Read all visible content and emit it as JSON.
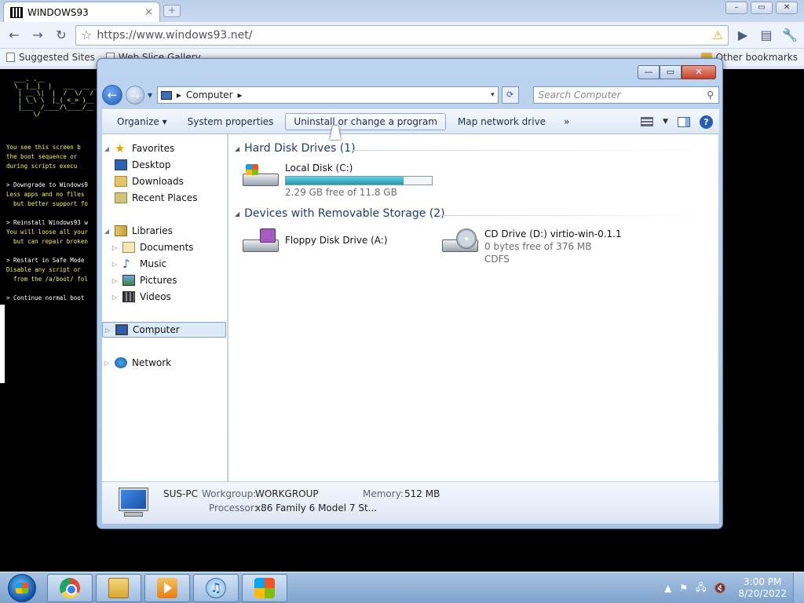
{
  "browser": {
    "tab_title": "WINDOWS93",
    "tab_close": "×",
    "newtab": "+",
    "win_min": "–",
    "win_max": "▭",
    "win_close": "✕",
    "url": "https://www.windows93.net/",
    "bookmarks": [
      {
        "label": "Suggested Sites"
      },
      {
        "label": "Web Slice Gallery"
      }
    ],
    "other_bookmarks": "Other bookmarks",
    "icons": {
      "back": "←",
      "forward": "→",
      "reload": "↻",
      "star": "☆",
      "warning": "⚠",
      "go": "▶",
      "page": "▤",
      "wrench": "🔧"
    }
  },
  "bootscreen": {
    "ascii": "___. .__\n\\_ |__|  |   ___  __ ___\n | __ \\|  |  /  \\/  / _ \\_\n | \\_\\ \\  |_( <_> )__\n |___  /____/\\____/__\n     \\/",
    "lines": [
      {
        "text": "You see this screen b",
        "color": "y"
      },
      {
        "text": "the boot sequence or",
        "color": "y"
      },
      {
        "text": "during scripts execu",
        "color": "y"
      },
      {
        "text": "> Downgrade to Windows9",
        "color": "w"
      },
      {
        "text": "Less apps and no files",
        "color": "y"
      },
      {
        "text": "  but better support fo",
        "color": "y"
      },
      {
        "text": "> Reinstall Windows93 w",
        "color": "w"
      },
      {
        "text": "You will loose all your",
        "color": "y"
      },
      {
        "text": "  but can repair broken",
        "color": "y"
      },
      {
        "text": "> Restart in Safe Mode",
        "color": "w"
      },
      {
        "text": "Disable any script or",
        "color": "y"
      },
      {
        "text": "  from the /a/boot/ fol",
        "color": "y"
      },
      {
        "text": "> Continue normal boot",
        "color": "w"
      }
    ]
  },
  "explorer": {
    "caption_buttons": {
      "minimize": "—",
      "maximize": "▭",
      "close": "✕"
    },
    "address": {
      "root_arrow": "▸",
      "location": "Computer",
      "after_arrow": "▸",
      "dropdown": "▾",
      "refresh": "⟳"
    },
    "search_placeholder": "Search Computer",
    "commands": {
      "organize": "Organize ▾",
      "system_properties": "System properties",
      "uninstall": "Uninstall or change a program",
      "map_network": "Map network drive",
      "more": "»",
      "help": "?"
    },
    "nav": {
      "favorites": "Favorites",
      "desktop": "Desktop",
      "downloads": "Downloads",
      "recent": "Recent Places",
      "libraries": "Libraries",
      "documents": "Documents",
      "music": "Music",
      "pictures": "Pictures",
      "videos": "Videos",
      "computer": "Computer",
      "network": "Network"
    },
    "groups": {
      "hdd": "Hard Disk Drives (1)",
      "removable": "Devices with Removable Storage (2)"
    },
    "drives": {
      "local": {
        "name": "Local Disk (C:)",
        "free": "2.29 GB free of 11.8 GB",
        "used_fraction": 0.806
      },
      "floppy": {
        "name": "Floppy Disk Drive (A:)"
      },
      "cd": {
        "name": "CD Drive (D:) virtio-win-0.1.1",
        "free": "0 bytes free of 376 MB",
        "fs": "CDFS"
      }
    },
    "details": {
      "pc_name": "SUS-PC",
      "workgroup_label": "Workgroup:",
      "workgroup": "WORKGROUP",
      "memory_label": "Memory:",
      "memory": "512 MB",
      "processor_label": "Processor:",
      "processor": "x86 Family 6 Model 7 St..."
    }
  },
  "taskbar": {
    "clock_time": "3:00 PM",
    "clock_date": "8/20/2022",
    "tray": {
      "up": "▲",
      "flag": "⚑",
      "network": "🖧",
      "volume": "🔇"
    },
    "itunes_glyph": "♫"
  }
}
